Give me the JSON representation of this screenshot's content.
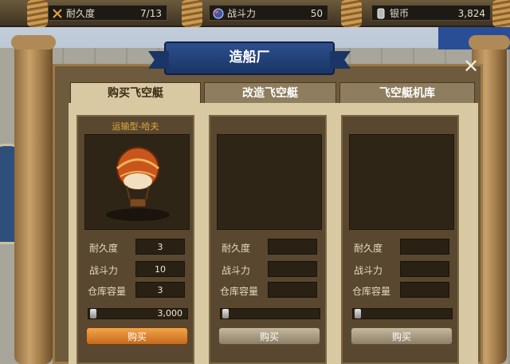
{
  "resources": [
    {
      "icon": "crossed-swords-icon",
      "label": "耐久度",
      "value": "7/13"
    },
    {
      "icon": "combat-power-icon",
      "label": "战斗力",
      "value": "50"
    },
    {
      "icon": "silver-coin-icon",
      "label": "银币",
      "value": "3,824"
    }
  ],
  "dialog": {
    "title": "造船厂",
    "close": "✕"
  },
  "tabs": [
    {
      "label": "购买飞空艇",
      "active": true
    },
    {
      "label": "改造飞空艇",
      "active": false
    },
    {
      "label": "飞空艇机库",
      "active": false
    }
  ],
  "stat_labels": {
    "durability": "耐久度",
    "combat": "战斗力",
    "storage": "仓库容量"
  },
  "cards": [
    {
      "name": "运输型-哈夫",
      "durability": "3",
      "combat": "10",
      "storage": "3",
      "price": "3,000",
      "buy": "购买",
      "enabled": true
    },
    {
      "name": "",
      "durability": "",
      "combat": "",
      "storage": "",
      "price": "",
      "buy": "购买",
      "enabled": false
    },
    {
      "name": "",
      "durability": "",
      "combat": "",
      "storage": "",
      "price": "",
      "buy": "购买",
      "enabled": false
    }
  ],
  "colors": {
    "banner": "#1a3566",
    "buy_active": "#e08a33",
    "gold_text": "#e1a940"
  }
}
